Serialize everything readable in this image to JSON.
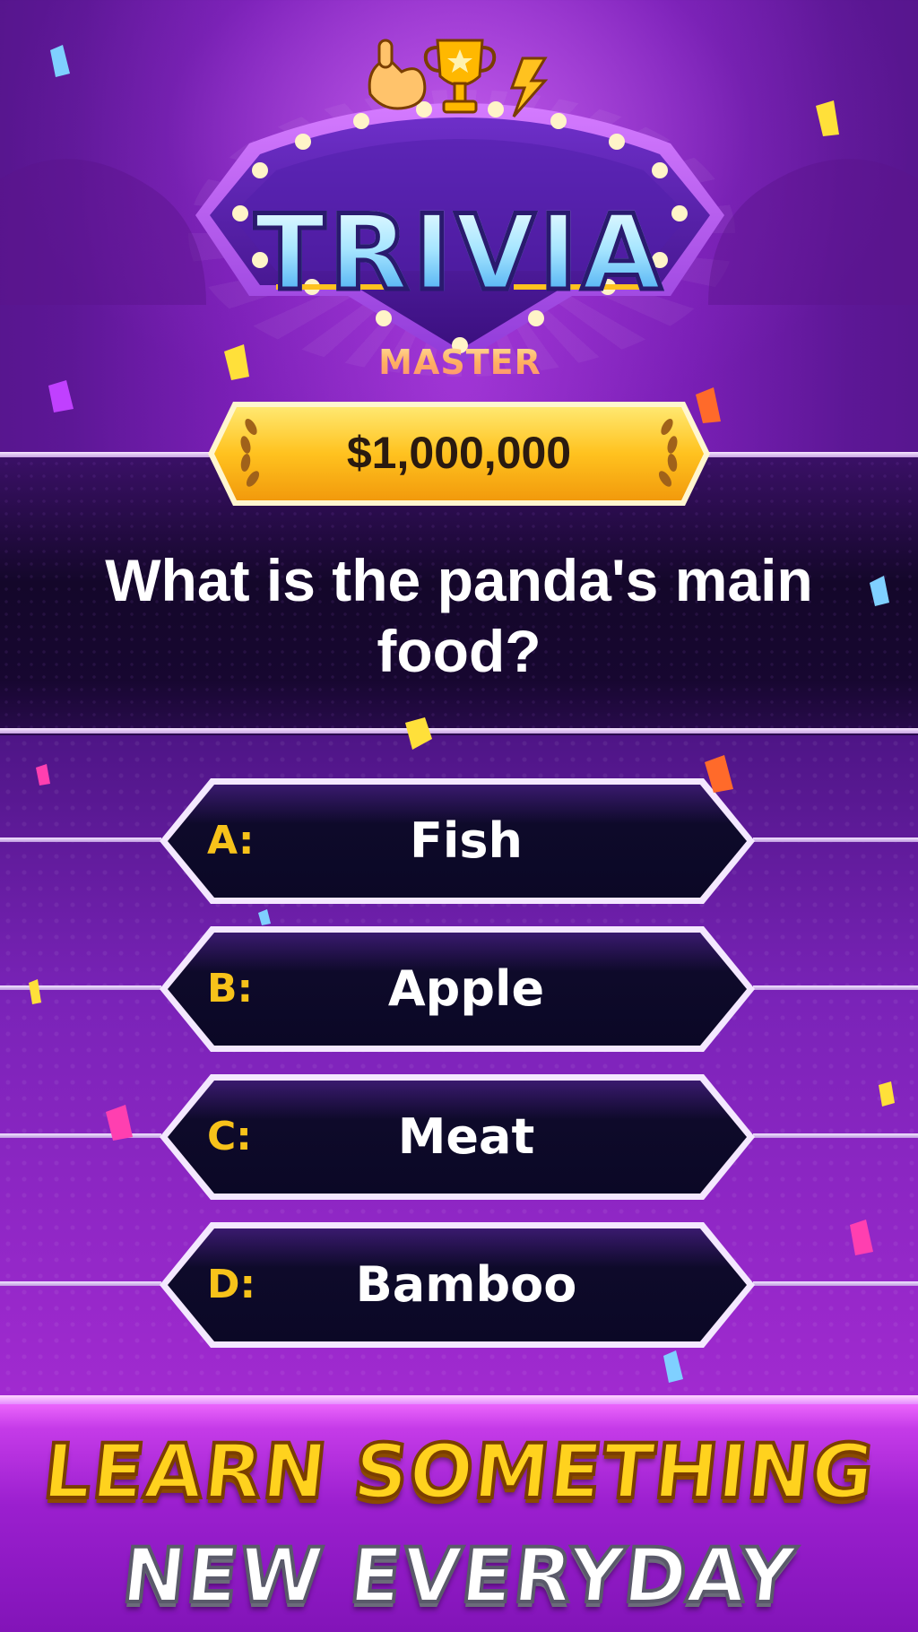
{
  "logo": {
    "title": "TRIVIA",
    "subtitle": "MASTER",
    "icons": [
      "shaka-hand-icon",
      "trophy-icon",
      "lightning-bolt-icon"
    ]
  },
  "prize": {
    "amount": "$1,000,000"
  },
  "question": {
    "text": "What is the panda's main food?"
  },
  "answers": [
    {
      "letter": "A:",
      "text": "Fish"
    },
    {
      "letter": "B:",
      "text": "Apple"
    },
    {
      "letter": "C:",
      "text": "Meat"
    },
    {
      "letter": "D:",
      "text": "Bamboo"
    }
  ],
  "banner": {
    "line1": "LEARN SOMETHING",
    "line2": "NEW EVERYDAY"
  },
  "colors": {
    "background": "#7a1fb6",
    "answer_letter": "#f7c21a",
    "prize_plate": "#ffc21f",
    "banner_line1": "#ffd21e",
    "banner_line2": "#ffffff"
  }
}
